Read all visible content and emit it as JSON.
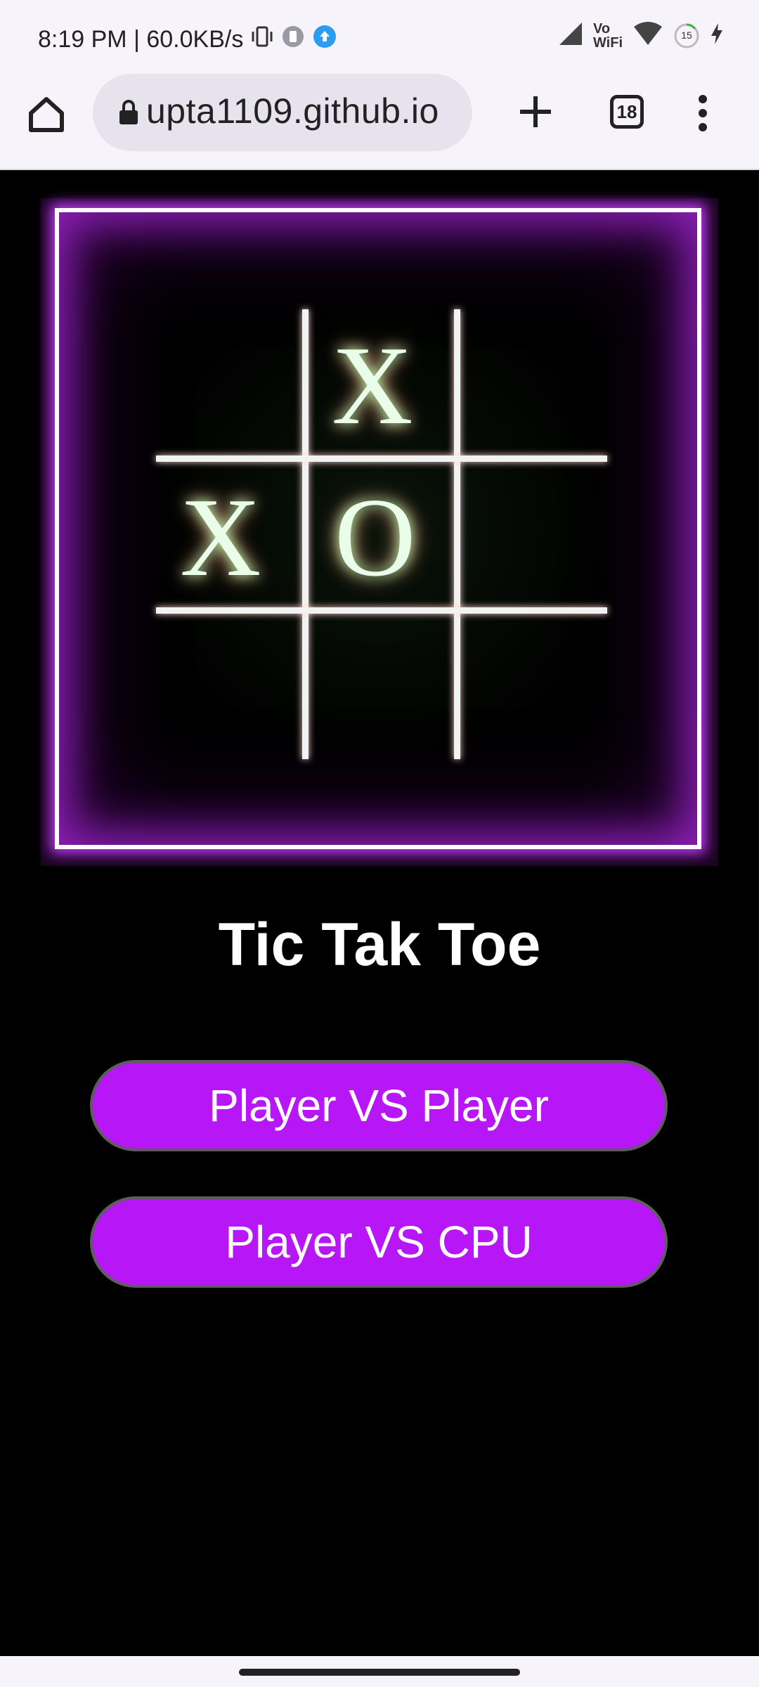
{
  "status": {
    "time_speed": "8:19 PM | 60.0KB/s",
    "vowifi_top": "Vo",
    "vowifi_bottom": "WiFi",
    "battery_level": "15"
  },
  "browser": {
    "url": "upta1109.github.io",
    "tab_count": "18"
  },
  "board": {
    "cells": [
      [
        "",
        "X",
        ""
      ],
      [
        "X",
        "O",
        ""
      ],
      [
        "",
        "",
        ""
      ]
    ]
  },
  "page": {
    "title": "Tic Tak Toe",
    "buttons": [
      {
        "label": "Player VS Player"
      },
      {
        "label": "Player VS CPU"
      }
    ]
  },
  "colors": {
    "accent": "#b716f7",
    "frame_glow": "#c63bff",
    "background": "#000000"
  }
}
